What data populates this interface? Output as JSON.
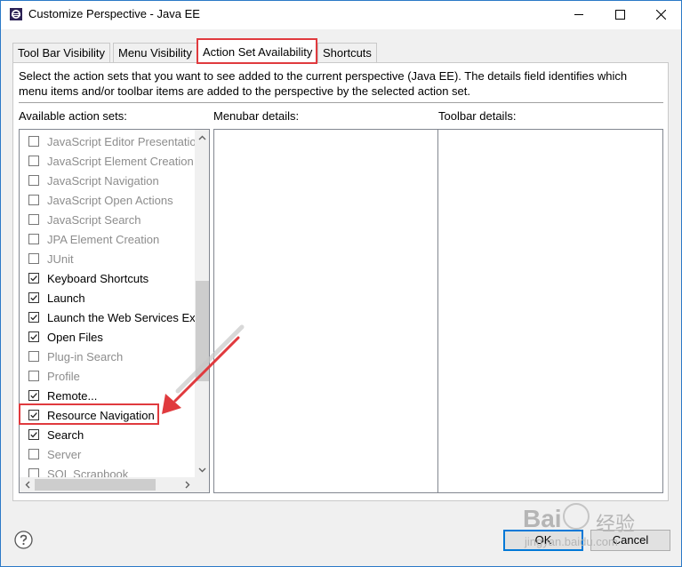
{
  "window": {
    "title": "Customize Perspective - Java EE",
    "controls": {
      "minimize": "minimize",
      "maximize": "maximize",
      "close": "close"
    }
  },
  "tabs": [
    {
      "label": "Tool Bar Visibility",
      "active": false
    },
    {
      "label": "Menu Visibility",
      "active": false
    },
    {
      "label": "Action Set Availability",
      "active": true
    },
    {
      "label": "Shortcuts",
      "active": false
    }
  ],
  "description": {
    "line1": "Select the action sets that you want to see added to the current perspective (Java EE).  The details field identifies which",
    "line2": "menu items and/or toolbar items are added to the perspective by the selected action set."
  },
  "labels": {
    "available": "Available action sets:",
    "menubar": "Menubar details:",
    "toolbar": "Toolbar details:"
  },
  "action_sets": [
    {
      "label": "JavaScript Editor Presentation",
      "checked": false,
      "enabled": false
    },
    {
      "label": "JavaScript Element Creation",
      "checked": false,
      "enabled": false
    },
    {
      "label": "JavaScript Navigation",
      "checked": false,
      "enabled": false
    },
    {
      "label": "JavaScript Open Actions",
      "checked": false,
      "enabled": false
    },
    {
      "label": "JavaScript Search",
      "checked": false,
      "enabled": false
    },
    {
      "label": "JPA Element Creation",
      "checked": false,
      "enabled": false
    },
    {
      "label": "JUnit",
      "checked": false,
      "enabled": false
    },
    {
      "label": "Keyboard Shortcuts",
      "checked": true,
      "enabled": true
    },
    {
      "label": "Launch",
      "checked": true,
      "enabled": true
    },
    {
      "label": "Launch the Web Services Explorer",
      "checked": true,
      "enabled": true
    },
    {
      "label": "Open Files",
      "checked": true,
      "enabled": true
    },
    {
      "label": "Plug-in Search",
      "checked": false,
      "enabled": false
    },
    {
      "label": "Profile",
      "checked": false,
      "enabled": false
    },
    {
      "label": "Remote...",
      "checked": true,
      "enabled": true
    },
    {
      "label": "Resource Navigation",
      "checked": true,
      "enabled": true
    },
    {
      "label": "Search",
      "checked": true,
      "enabled": true
    },
    {
      "label": "Server",
      "checked": false,
      "enabled": false
    },
    {
      "label": "SQL Scrapbook",
      "checked": false,
      "enabled": false
    }
  ],
  "buttons": {
    "ok": "OK",
    "cancel": "Cancel"
  },
  "watermark": {
    "brand": "Bai",
    "brand_cn": "经验",
    "url": "jingyan.baidu.com"
  },
  "colors": {
    "highlight": "#e03a3e",
    "accent": "#0078d7"
  }
}
